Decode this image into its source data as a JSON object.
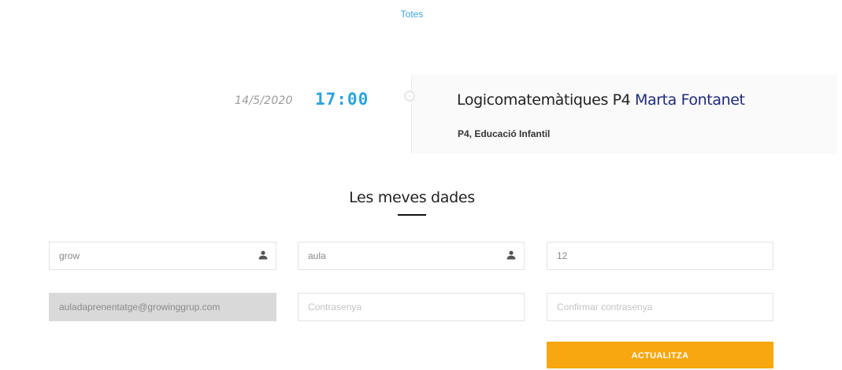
{
  "filter": {
    "all_label": "Totes"
  },
  "event": {
    "date": "14/5/2020",
    "time": "17:00",
    "title": "Logicomatemàtiques P4",
    "teacher": "Marta Fontanet",
    "group": "P4, Educació Infantil"
  },
  "profile": {
    "title": "Les meves dades",
    "fields": {
      "first_name": {
        "value": "grow",
        "icon": "user-icon"
      },
      "last_name": {
        "value": "aula",
        "icon": "user-icon"
      },
      "number": {
        "value": "12"
      },
      "email": {
        "value": "auladaprenentatge@growinggrup.com"
      },
      "password": {
        "placeholder": "Contrasenya"
      },
      "confirm_password": {
        "placeholder": "Confirmar contrasenya"
      }
    },
    "submit_label": "ACTUALITZA"
  },
  "colors": {
    "accent_blue": "#2aa4dc",
    "teacher_navy": "#1f2a7a",
    "button_orange": "#f7a70f"
  }
}
